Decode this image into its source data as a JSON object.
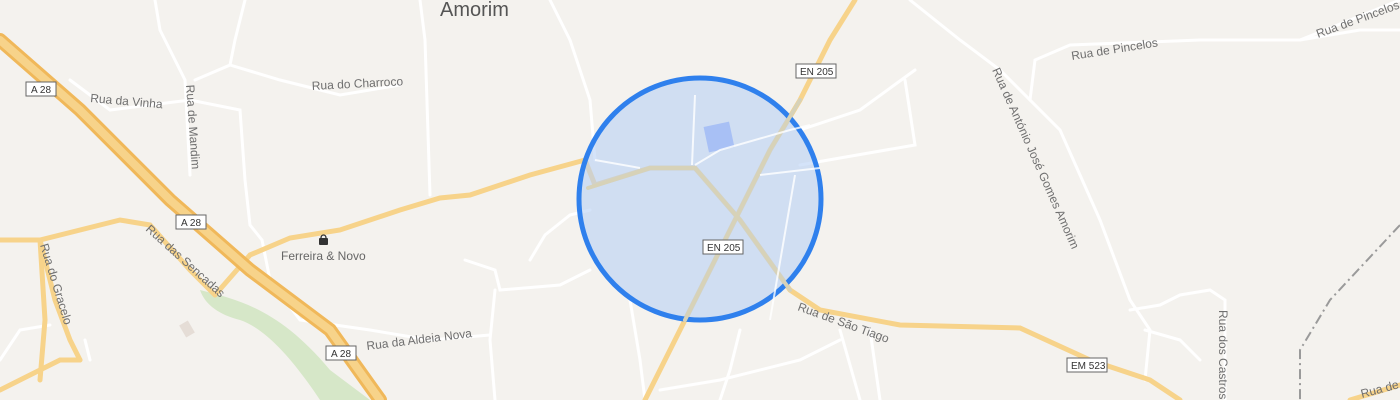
{
  "map": {
    "place_name": "Amorim",
    "colors": {
      "background": "#f4f2ee",
      "minor_road": "#ffffff",
      "major_road": "#f7d38a",
      "motorway": "#f0b85a",
      "circle_fill": "#b8d0f5",
      "circle_stroke": "#2f80ed",
      "green_area": "#d6e7c8",
      "rail": "#9a9a9a"
    },
    "streets": [
      "Rua da Vinha",
      "Rua de Mandim",
      "Rua do Charroco",
      "Rua das Sencadas",
      "Rua do Gracelo",
      "Rua da Aldeia Nova",
      "Rua de São Tiago",
      "Rua de António José Gomes Amorim",
      "Rua de Pincelos",
      "Rua de Pincelos",
      "Rua dos Castros",
      "Rua de"
    ],
    "shields": [
      "A 28",
      "A 28",
      "A 28",
      "EN 205",
      "EN 205",
      "EM 523"
    ],
    "poi": {
      "label": "Ferreira & Novo",
      "icon": "shopping-bag-icon"
    },
    "search_radius": {
      "icon": "radius-circle"
    }
  }
}
